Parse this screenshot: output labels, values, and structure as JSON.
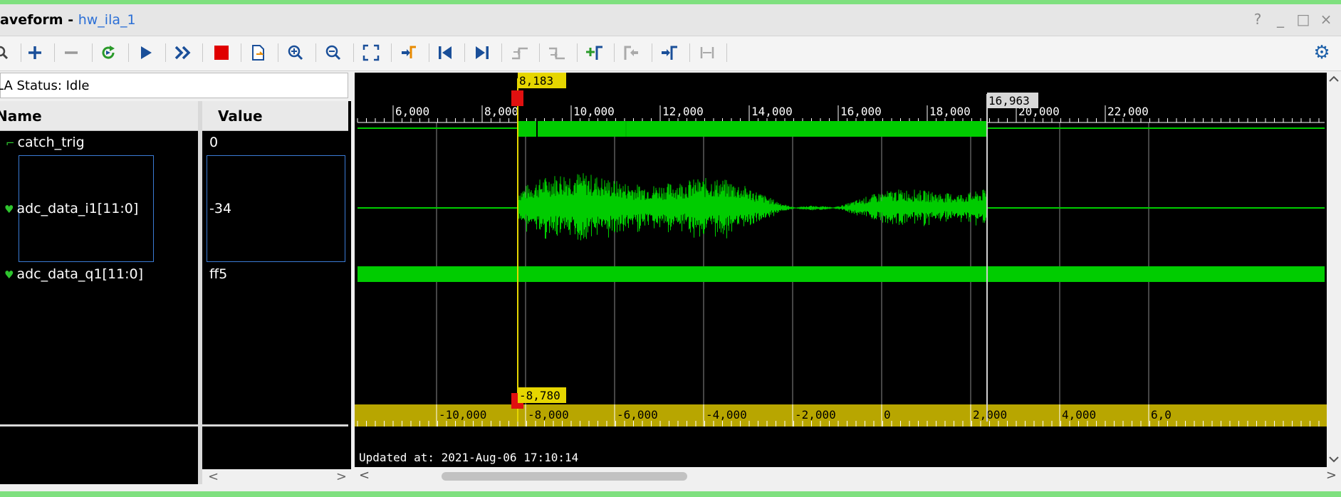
{
  "window": {
    "title_prefix": "aveform - ",
    "title_link": "hw_ila_1",
    "controls": [
      "?",
      "_",
      "□",
      "×"
    ]
  },
  "toolbar": {
    "buttons": [
      {
        "name": "search-icon",
        "glyph": "🔍"
      },
      {
        "name": "add-icon",
        "glyph": "+"
      },
      {
        "name": "remove-icon",
        "glyph": "−"
      },
      {
        "name": "run-trigger-immediate-icon",
        "glyph": "↻"
      },
      {
        "name": "run-trigger-icon",
        "glyph": "▶"
      },
      {
        "name": "run-immediate-icon",
        "glyph": "»"
      },
      {
        "name": "stop-icon",
        "glyph": "■"
      },
      {
        "name": "export-icon",
        "glyph": "⎘"
      },
      {
        "name": "zoom-in-icon",
        "glyph": "⊕"
      },
      {
        "name": "zoom-out-icon",
        "glyph": "⊖"
      },
      {
        "name": "zoom-fit-icon",
        "glyph": "⤢"
      },
      {
        "name": "go-to-cursor-icon",
        "glyph": "⇥"
      },
      {
        "name": "go-to-start-icon",
        "glyph": "⏮"
      },
      {
        "name": "go-to-end-icon",
        "glyph": "⏭"
      },
      {
        "name": "previous-transition-icon",
        "glyph": "⇤"
      },
      {
        "name": "next-transition-icon",
        "glyph": "⇥"
      },
      {
        "name": "add-marker-icon",
        "glyph": "+⌐"
      },
      {
        "name": "previous-marker-icon",
        "glyph": "⌐"
      },
      {
        "name": "next-marker-icon",
        "glyph": "⌐"
      },
      {
        "name": "swap-cursors-icon",
        "glyph": "⇔"
      }
    ],
    "settings_icon": "⚙"
  },
  "status": {
    "text": "LA Status: Idle"
  },
  "columns": {
    "name": "Name",
    "value": "Value"
  },
  "signals": [
    {
      "name": "catch_trig",
      "value": "0",
      "icon": "bit-signal-icon"
    },
    {
      "name": "adc_data_i1[11:0]",
      "value": "-34",
      "icon": "bus-signal-icon"
    },
    {
      "name": "adc_data_q1[11:0]",
      "value": "ff5",
      "icon": "bus-signal-icon"
    }
  ],
  "waveform": {
    "top_ruler": [
      "6,000",
      "8,000",
      "10,000",
      "12,000",
      "14,000",
      "16,000",
      "18,000",
      "20,000",
      "22,000"
    ],
    "bottom_ruler": [
      "-10,000",
      "-8,000",
      "-6,000",
      "-4,000",
      "-2,000",
      "0",
      "2,000",
      "4,000",
      "6,0"
    ],
    "cursor_label": "8,183",
    "marker_label": "16,963",
    "cursor_delta_label": "-8,780",
    "updated": "Updated at: 2021-Aug-06 17:10:14"
  },
  "scrollbar": {
    "left": "<",
    "right": ">"
  },
  "colors": {
    "trace": "#00cc00",
    "cursor": "#e6d600",
    "ruler_bottom": "#b8a600",
    "grid": "#8a8a8a",
    "marker_label_bg": "#d8d8d8",
    "link": "#2b6fd6"
  }
}
